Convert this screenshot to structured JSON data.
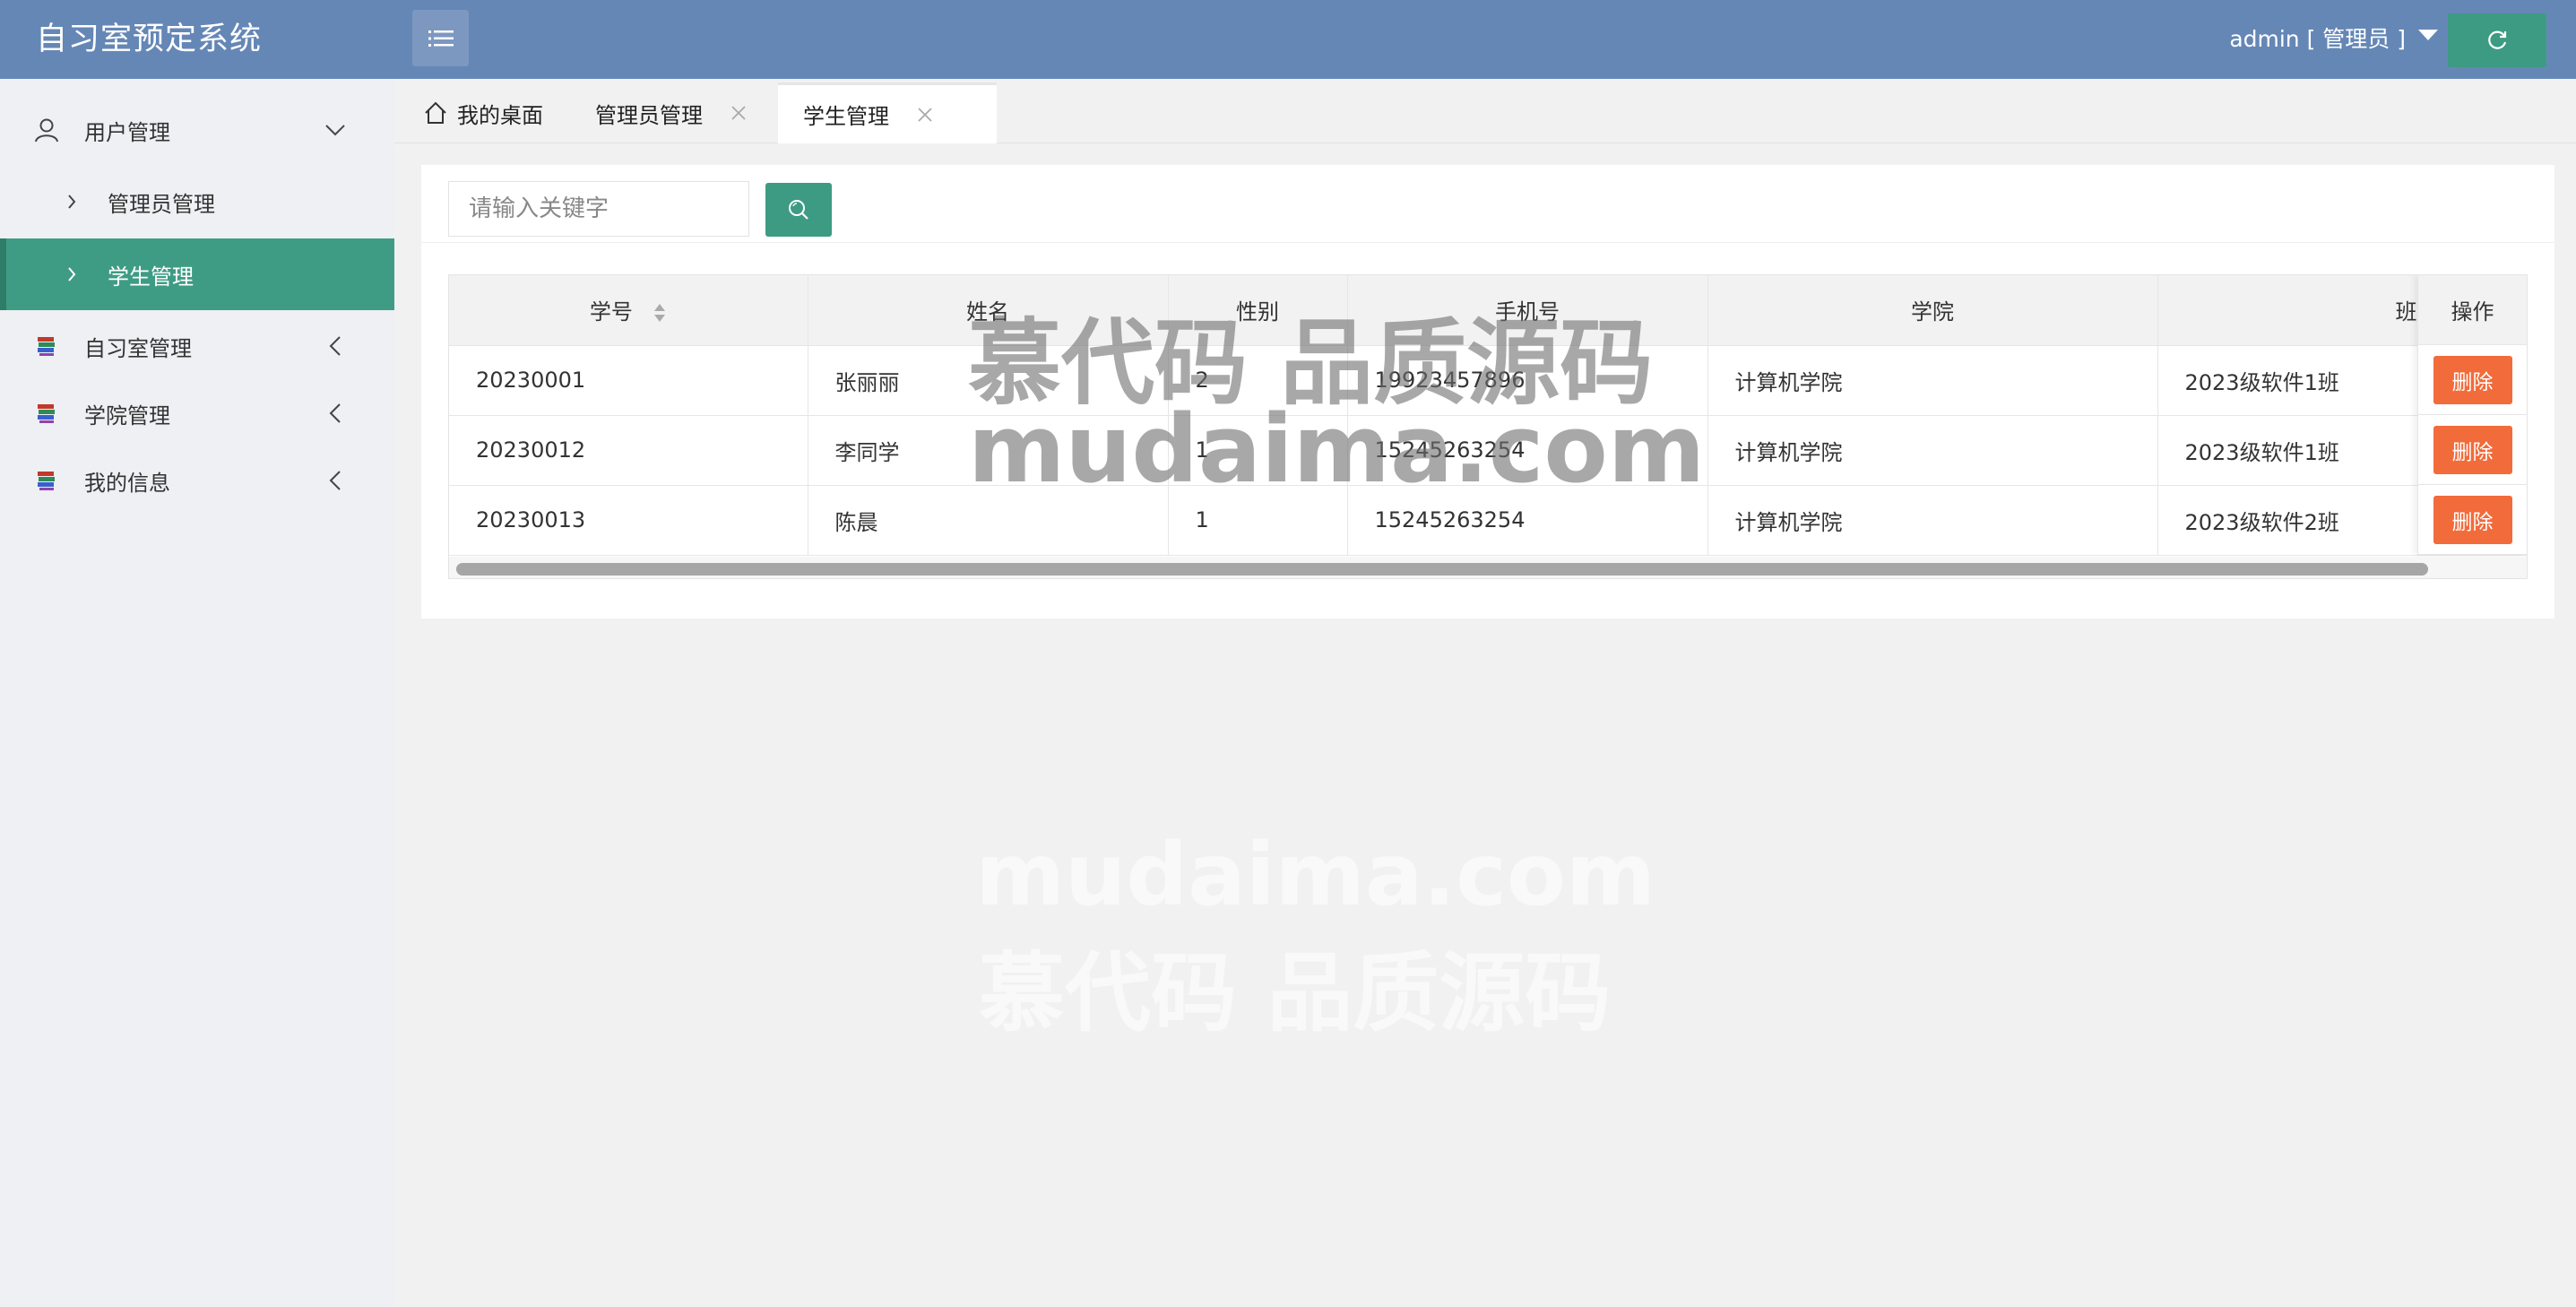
{
  "app": {
    "title": "自习室预定系统",
    "user_label": "admin [ 管理员 ]"
  },
  "colors": {
    "header": "#6587b6",
    "accent": "#3d9b83",
    "danger": "#f26b3a"
  },
  "sidebar": {
    "groups": [
      {
        "label": "用户管理",
        "icon": "user-icon",
        "expanded": true,
        "children": [
          {
            "label": "管理员管理",
            "active": false
          },
          {
            "label": "学生管理",
            "active": true
          }
        ]
      },
      {
        "label": "自习室管理",
        "icon": "books-icon",
        "expanded": false
      },
      {
        "label": "学院管理",
        "icon": "books-icon",
        "expanded": false
      },
      {
        "label": "我的信息",
        "icon": "books-icon",
        "expanded": false
      }
    ]
  },
  "tabs": [
    {
      "label": "我的桌面",
      "icon": "home-icon",
      "closable": false,
      "active": false
    },
    {
      "label": "管理员管理",
      "closable": true,
      "active": false
    },
    {
      "label": "学生管理",
      "closable": true,
      "active": true
    }
  ],
  "search": {
    "placeholder": "请输入关键字"
  },
  "table": {
    "columns": [
      "学号",
      "姓名",
      "性别",
      "手机号",
      "学院",
      "班级",
      "操作"
    ],
    "rows": [
      [
        "20230001",
        "张丽丽",
        "2",
        "19923457896",
        "计算机学院",
        "2023级软件1班"
      ],
      [
        "20230012",
        "李同学",
        "1",
        "15245263254",
        "计算机学院",
        "2023级软件1班"
      ],
      [
        "20230013",
        "陈晨",
        "1",
        "15245263254",
        "计算机学院",
        "2023级软件2班"
      ]
    ],
    "action_label": "删除"
  },
  "watermark": {
    "line_cn": "慕代码 品质源码",
    "line_en": "mudaima.com"
  }
}
